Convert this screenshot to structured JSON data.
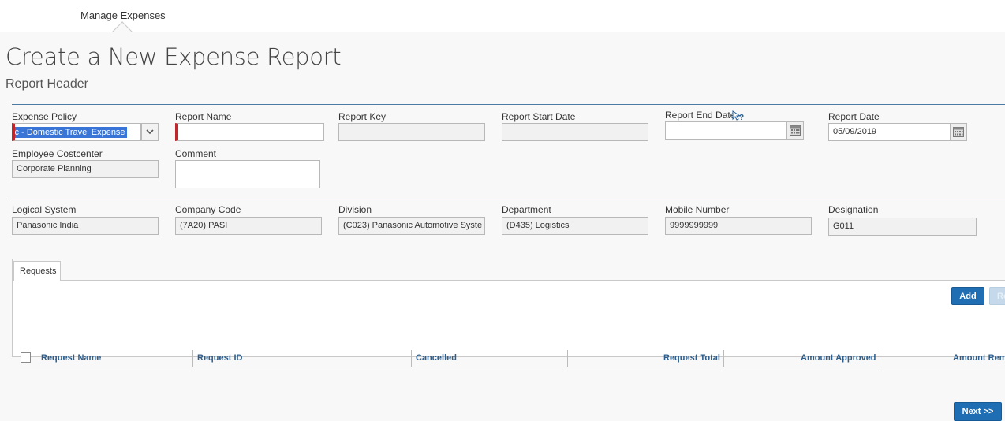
{
  "nav": {
    "tab_label": "Manage Expenses"
  },
  "page": {
    "title": "Create a New Expense Report",
    "subtitle": "Report Header"
  },
  "fields": {
    "expense_policy": {
      "label": "Expense Policy",
      "value": "nic - Domestic Travel Expense"
    },
    "report_name": {
      "label": "Report Name",
      "value": ""
    },
    "report_key": {
      "label": "Report Key",
      "value": ""
    },
    "report_start_date": {
      "label": "Report Start Date",
      "value": ""
    },
    "report_end_date": {
      "label": "Report End Date",
      "value": ""
    },
    "report_date": {
      "label": "Report Date",
      "value": "05/09/2019"
    },
    "employee_costcenter": {
      "label": "Employee Costcenter",
      "value": "Corporate Planning"
    },
    "comment": {
      "label": "Comment",
      "value": ""
    },
    "logical_system": {
      "label": "Logical System",
      "value": "Panasonic India"
    },
    "company_code": {
      "label": "Company Code",
      "value": "(7A20) PASI"
    },
    "division": {
      "label": "Division",
      "value": "(C023) Panasonic Automotive Syste"
    },
    "department": {
      "label": "Department",
      "value": "(D435) Logistics"
    },
    "mobile_number": {
      "label": "Mobile Number",
      "value": "9999999999"
    },
    "designation": {
      "label": "Designation",
      "value": "G011"
    }
  },
  "requests": {
    "tab_label": "Requests",
    "add_label": "Add",
    "remove_label": "Re",
    "columns": [
      "Request Name",
      "Request ID",
      "Cancelled",
      "Request Total",
      "Amount Approved",
      "Amount Rem"
    ]
  },
  "footer": {
    "next_label": "Next >>"
  },
  "colors": {
    "accent": "#1f6db3",
    "required": "#c0272d",
    "divider": "#4a7ba5",
    "header_text": "#2e5e8c"
  },
  "icons": {
    "dropdown": "chevron-down-icon",
    "calendar": "calendar-icon",
    "help": "help-cursor-icon"
  }
}
